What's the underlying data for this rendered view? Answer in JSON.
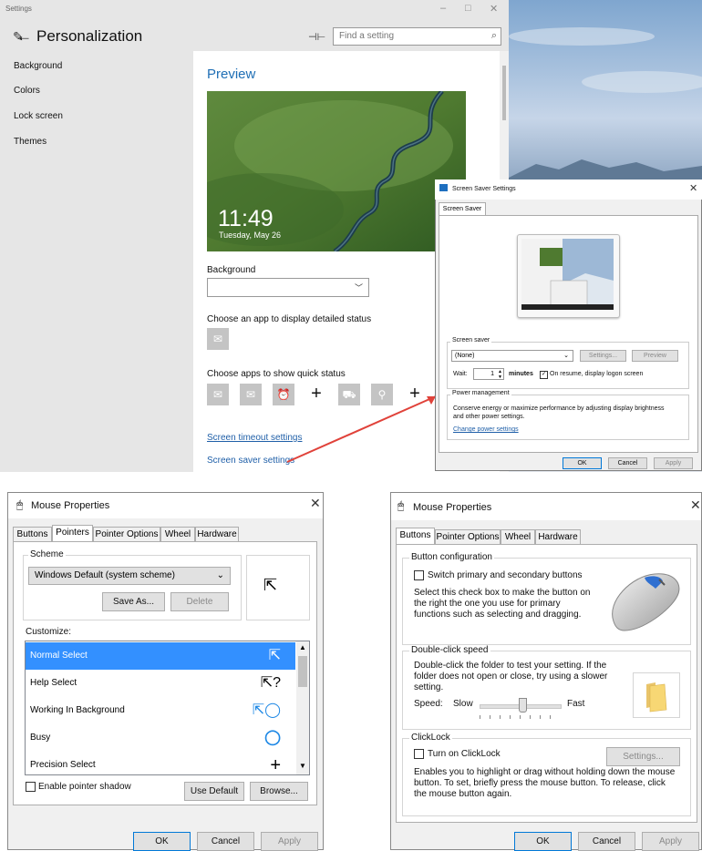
{
  "settings": {
    "window_title": "Settings",
    "heading": "Personalization",
    "search_placeholder": "Find a setting",
    "nav": [
      "Background",
      "Colors",
      "Lock screen",
      "Themes"
    ],
    "preview_title": "Preview",
    "clock_time": "11:49",
    "clock_date": "Tuesday, May 26",
    "background_label": "Background",
    "detailed_status_label": "Choose an app to display detailed status",
    "quick_status_label": "Choose apps to show quick status",
    "link_timeout": "Screen timeout settings",
    "link_screensaver": "Screen saver settings"
  },
  "screensaver_dialog": {
    "title": "Screen Saver Settings",
    "tab": "Screen Saver",
    "group_screensaver": "Screen saver",
    "selected": "(None)",
    "settings_btn": "Settings...",
    "preview_btn": "Preview",
    "wait_label": "Wait:",
    "wait_value": "1",
    "minutes_label": "minutes",
    "resume_label": "On resume, display logon screen",
    "resume_checked": true,
    "group_power": "Power management",
    "power_text": "Conserve energy or maximize performance by adjusting display brightness and other power settings.",
    "power_link": "Change power settings",
    "ok": "OK",
    "cancel": "Cancel",
    "apply": "Apply"
  },
  "mouse_pointers": {
    "title": "Mouse Properties",
    "tabs": [
      "Buttons",
      "Pointers",
      "Pointer Options",
      "Wheel",
      "Hardware"
    ],
    "selected_tab": "Pointers",
    "scheme_label": "Scheme",
    "scheme_value": "Windows Default (system scheme)",
    "save_as": "Save As...",
    "delete": "Delete",
    "customize_label": "Customize:",
    "rows": [
      {
        "label": "Normal Select",
        "cursor": "arrow"
      },
      {
        "label": "Help Select",
        "cursor": "help-arrow"
      },
      {
        "label": "Working In Background",
        "cursor": "working-arrow"
      },
      {
        "label": "Busy",
        "cursor": "busy-ring"
      },
      {
        "label": "Precision Select",
        "cursor": "crosshair"
      }
    ],
    "selected_row": "Normal Select",
    "shadow_label": "Enable pointer shadow",
    "use_default": "Use Default",
    "browse": "Browse...",
    "ok": "OK",
    "cancel": "Cancel",
    "apply": "Apply"
  },
  "mouse_buttons": {
    "title": "Mouse Properties",
    "tabs": [
      "Buttons",
      "Pointer Options",
      "Wheel",
      "Hardware"
    ],
    "selected_tab": "Buttons",
    "btn_config_label": "Button configuration",
    "switch_label": "Switch primary and secondary buttons",
    "switch_desc": "Select this check box to make the button on the right the one you use for primary functions such as selecting and dragging.",
    "dblclick_label": "Double-click speed",
    "dblclick_desc": "Double-click the folder to test your setting. If the folder does not open or close, try using a slower setting.",
    "speed_label": "Speed:",
    "slow": "Slow",
    "fast": "Fast",
    "speed_value": 0.55,
    "clicklock_label": "ClickLock",
    "clicklock_check": "Turn on ClickLock",
    "clicklock_settings": "Settings...",
    "clicklock_desc": "Enables you to highlight or drag without holding down the mouse button. To set, briefly press the mouse button. To release, click the mouse button again.",
    "ok": "OK",
    "cancel": "Cancel",
    "apply": "Apply"
  },
  "colors": {
    "accent": "#1f6fb5",
    "selection": "#3390ff",
    "link": "#1f5fa8",
    "arrow": "#e0423a"
  }
}
